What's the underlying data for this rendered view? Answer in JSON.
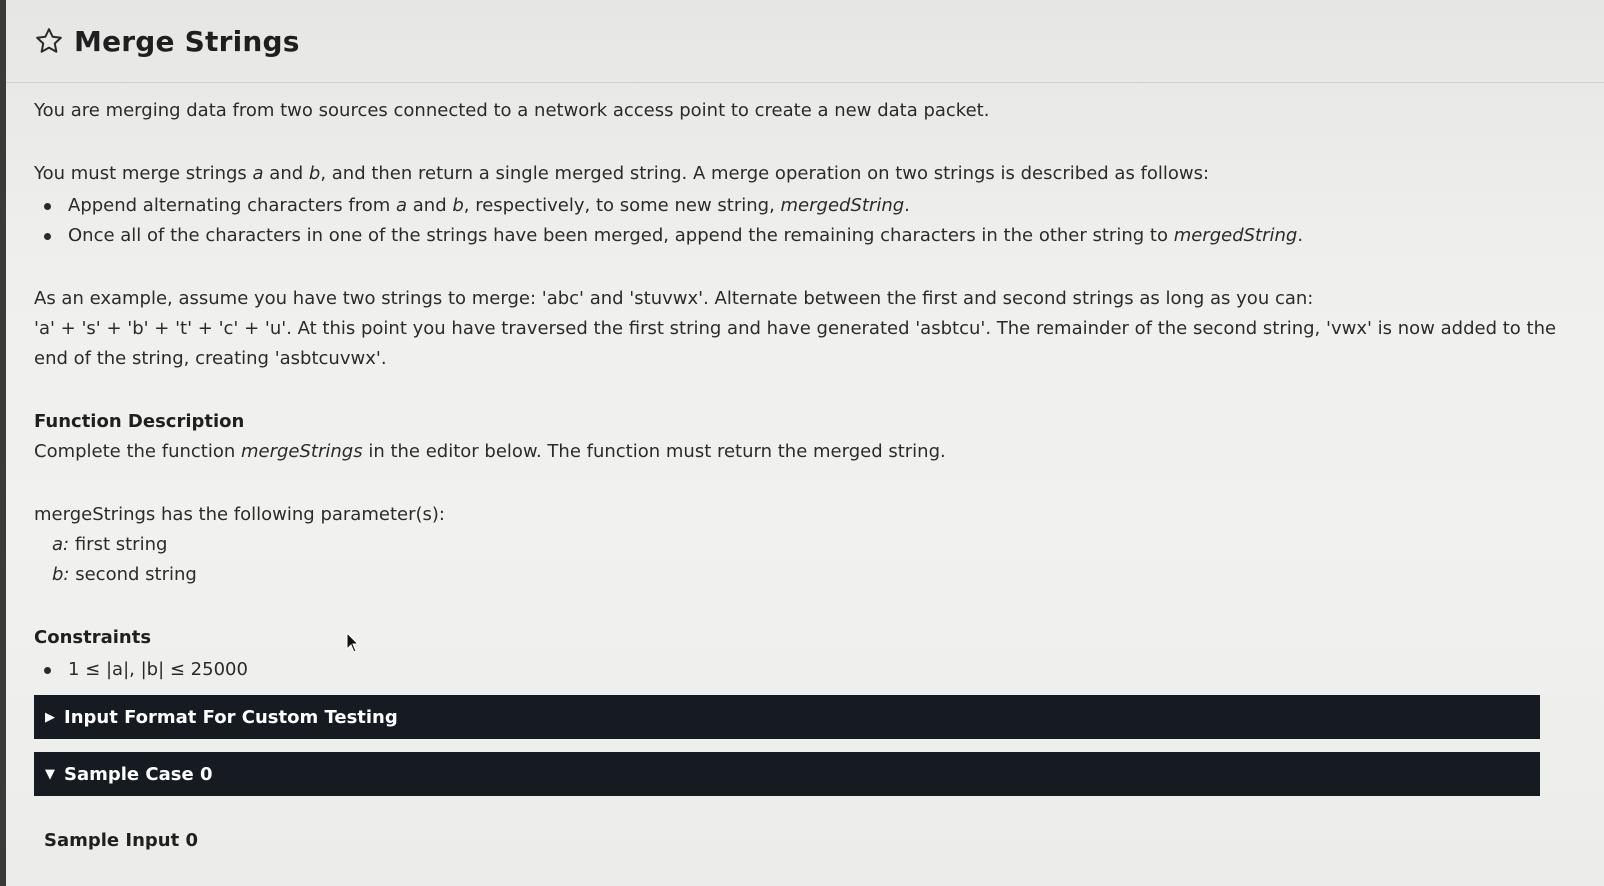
{
  "header": {
    "title": "Merge Strings",
    "star_icon": "star-outline-icon"
  },
  "description": {
    "intro": "You are merging data from two sources connected to a network access point to create a new data packet.",
    "merge_rule_a": "You must merge strings ",
    "merge_rule_var_a": "a",
    "merge_rule_b": " and ",
    "merge_rule_var_b": "b",
    "merge_rule_c": ", and then return a single merged string. A merge operation on two strings is described as follows:",
    "bullet1_a": "Append alternating characters from ",
    "bullet1_var_a": "a",
    "bullet1_b": " and ",
    "bullet1_var_b": "b",
    "bullet1_c": ", respectively, to some new string, ",
    "bullet1_var_merged": "mergedString",
    "bullet1_d": ".",
    "bullet2_a": "Once all of the characters in one of the strings have been merged, append the remaining characters in the other string to ",
    "bullet2_var_merged": "mergedString",
    "bullet2_b": ".",
    "example_line1": "As an example, assume you have two strings to merge: 'abc' and 'stuvwx'. Alternate between the first and second strings as long as you can:",
    "example_line2": "'a' + 's' + 'b' + 't' + 'c' + 'u'. At this point you have traversed the first string and have generated 'asbtcu'. The remainder of the second string, 'vwx' is now added to the end of the string, creating 'asbtcuvwx'."
  },
  "function_description": {
    "heading": "Function Description",
    "text_a": "Complete the function ",
    "text_var": "mergeStrings",
    "text_b": " in the editor below. The function must return the merged string.",
    "params_intro": "mergeStrings has the following parameter(s):",
    "params": [
      {
        "name": "a:",
        "desc": " first string"
      },
      {
        "name": "b:",
        "desc": " second string"
      }
    ]
  },
  "constraints": {
    "heading": "Constraints",
    "items": [
      "1 ≤ |a|, |b| ≤ 25000"
    ]
  },
  "sections": {
    "input_format": {
      "label": "Input Format For Custom Testing",
      "arrow": "▶",
      "expanded": false
    },
    "sample_case": {
      "label": "Sample Case 0",
      "arrow": "▼",
      "expanded": true
    }
  },
  "sample": {
    "input_label": "Sample Input 0"
  },
  "colors": {
    "section_bar": "#161b22",
    "text": "#2b2b2b"
  }
}
